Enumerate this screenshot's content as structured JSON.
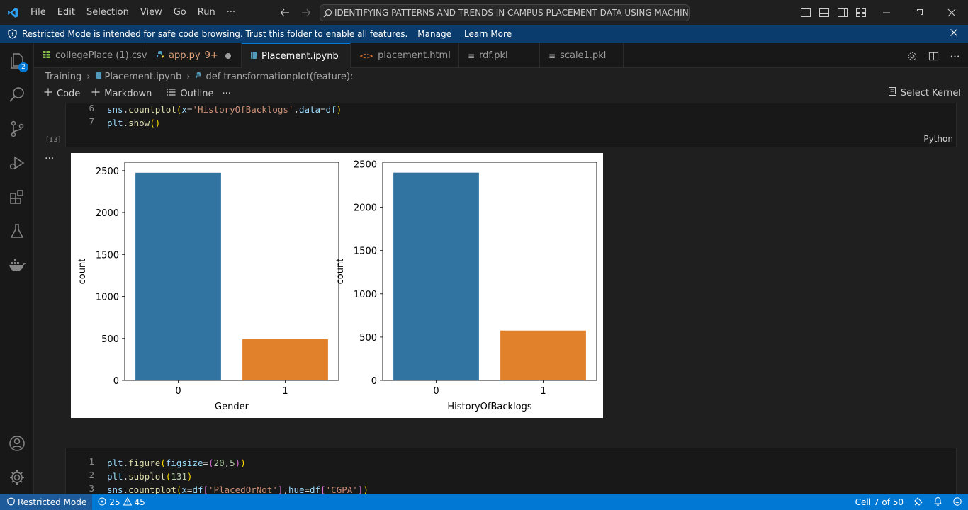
{
  "menu": [
    "File",
    "Edit",
    "Selection",
    "View",
    "Go",
    "Run",
    "···"
  ],
  "command_center": "IDENTIFYING PATTERNS AND TRENDS IN CAMPUS PLACEMENT DATA USING MACHINE LEAR...",
  "banner": {
    "text": "Restricted Mode is intended for safe code browsing. Trust this folder to enable all features.",
    "manage": "Manage",
    "learn_more": "Learn More"
  },
  "activity": {
    "explorer_badge": "2"
  },
  "tabs": [
    {
      "label": "collegePlace (1).csv",
      "icon": "csv-file-icon",
      "color": "#8bc34a"
    },
    {
      "label": "app.py",
      "suffix": "9+",
      "icon": "python-file-icon",
      "color": "#e2a27a"
    },
    {
      "label": "Placement.ipynb",
      "icon": "notebook-file-icon",
      "color": "#519aba",
      "active": true
    },
    {
      "label": "placement.html",
      "icon": "html-file-icon",
      "color": "#e37933"
    },
    {
      "label": "rdf.pkl",
      "icon": "generic-file-icon",
      "color": "#cccccc"
    },
    {
      "label": "scale1.pkl",
      "icon": "generic-file-icon",
      "color": "#cccccc"
    }
  ],
  "breadcrumb": [
    "Training",
    "Placement.ipynb",
    "def transformationplot(feature):"
  ],
  "toolbar": {
    "code": "Code",
    "markdown": "Markdown",
    "outline": "Outline",
    "more": "···",
    "select_kernel": "Select Kernel"
  },
  "cell1": {
    "exec_count": "[13]",
    "language": "Python",
    "line_numbers": [
      "6",
      "7"
    ]
  },
  "cell2": {
    "line_numbers": [
      "1",
      "2",
      "3"
    ]
  },
  "output_more": "···",
  "chart_data": [
    {
      "type": "bar",
      "categories": [
        "0",
        "1"
      ],
      "values": [
        2475,
        490
      ],
      "colors": [
        "#3274a1",
        "#e1812c"
      ],
      "xlabel": "Gender",
      "ylabel": "count",
      "yticks": [
        0,
        500,
        1000,
        1500,
        2000,
        2500
      ],
      "ylim": [
        0,
        2600
      ],
      "grid": false
    },
    {
      "type": "bar",
      "categories": [
        "0",
        "1"
      ],
      "values": [
        2400,
        575
      ],
      "colors": [
        "#3274a1",
        "#e1812c"
      ],
      "xlabel": "HistoryOfBacklogs",
      "ylabel": "count",
      "yticks": [
        0,
        500,
        1000,
        1500,
        2000,
        2500
      ],
      "ylim": [
        0,
        2520
      ],
      "grid": false
    }
  ],
  "status": {
    "restricted": "Restricted Mode",
    "errors": "25",
    "warnings": "45",
    "cell_position": "Cell 7 of 50"
  }
}
